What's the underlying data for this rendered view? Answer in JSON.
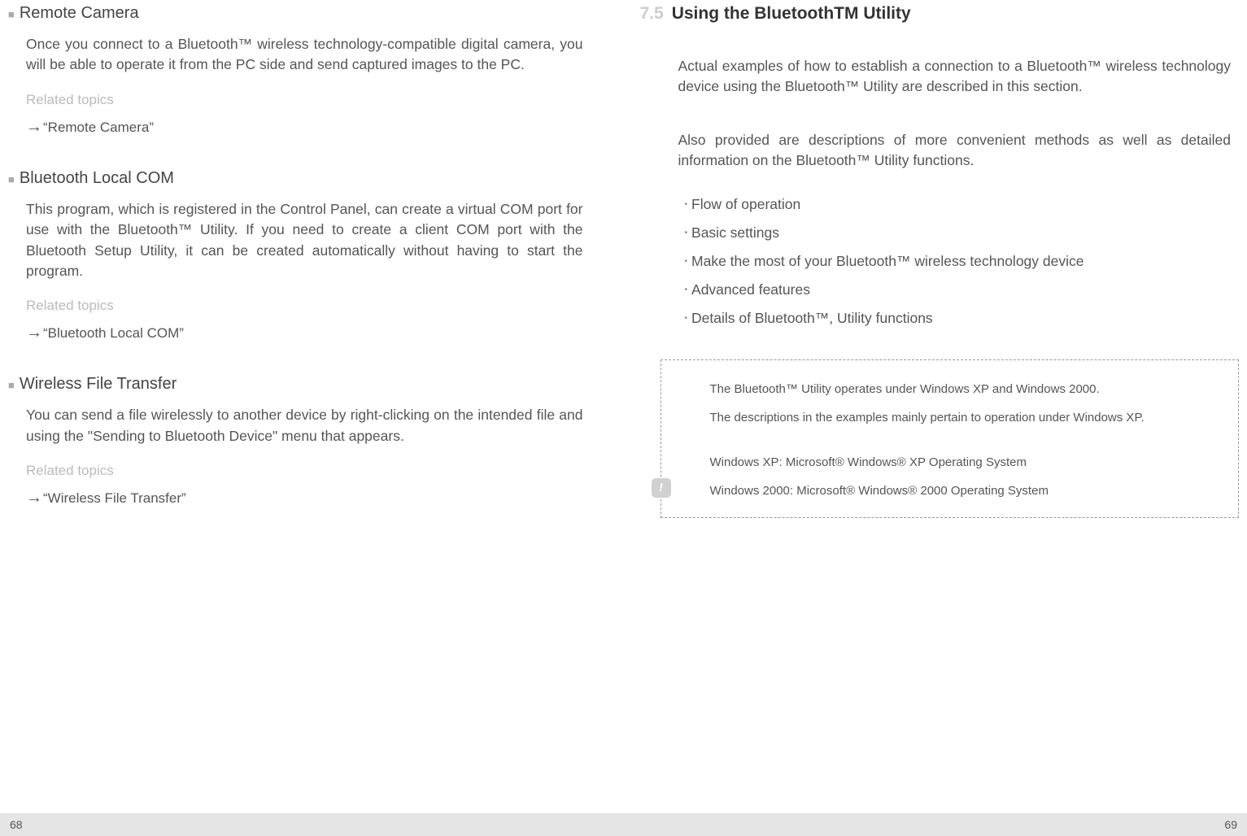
{
  "left": {
    "sections": [
      {
        "heading": "Remote Camera",
        "body": "Once you connect to a Bluetooth™ wireless technology-compatible digital camera, you will be able to operate it from the PC side and send captured images to the PC.",
        "relatedLabel": "Related topics",
        "relatedLink": "“Remote Camera”"
      },
      {
        "heading": "Bluetooth Local COM",
        "body": "This program, which is registered in the Control Panel, can create a virtual COM port for use with the Bluetooth™ Utility. If you need to create a client COM port with the Bluetooth Setup Utility, it can be created automatically without having to start the program.",
        "relatedLabel": "Related topics",
        "relatedLink": "“Bluetooth Local COM”"
      },
      {
        "heading": "Wireless File Transfer",
        "body": "You can send a file wirelessly to another device by right-clicking on the intended file and using the \"Sending to Bluetooth Device\" menu that appears.",
        "relatedLabel": "Related topics",
        "relatedLink": "“Wireless File Transfer”"
      }
    ]
  },
  "right": {
    "chapterNum": "7.5",
    "chapterTitle": "Using the BluetoothTM Utility",
    "intro1": "Actual examples of how to establish a connection to a Bluetooth™ wireless technology device using the Bluetooth™ Utility are described in this section.",
    "intro2": "Also provided are descriptions of more convenient methods as well as detailed information on the Bluetooth™ Utility functions.",
    "bullets": [
      "Flow of operation",
      "Basic settings",
      "Make the most of your Bluetooth™ wireless technology device",
      "Advanced features",
      "Details of Bluetooth™, Utility functions"
    ],
    "infobox": {
      "line1": "The Bluetooth™ Utility operates under Windows XP and Windows 2000.",
      "line2": "The descriptions in the examples mainly pertain to operation under Windows XP.",
      "line3": "Windows XP: Microsoft® Windows® XP Operating System",
      "line4": "Windows 2000: Microsoft® Windows® 2000 Operating System"
    }
  },
  "footer": {
    "left": "68",
    "right": "69"
  }
}
